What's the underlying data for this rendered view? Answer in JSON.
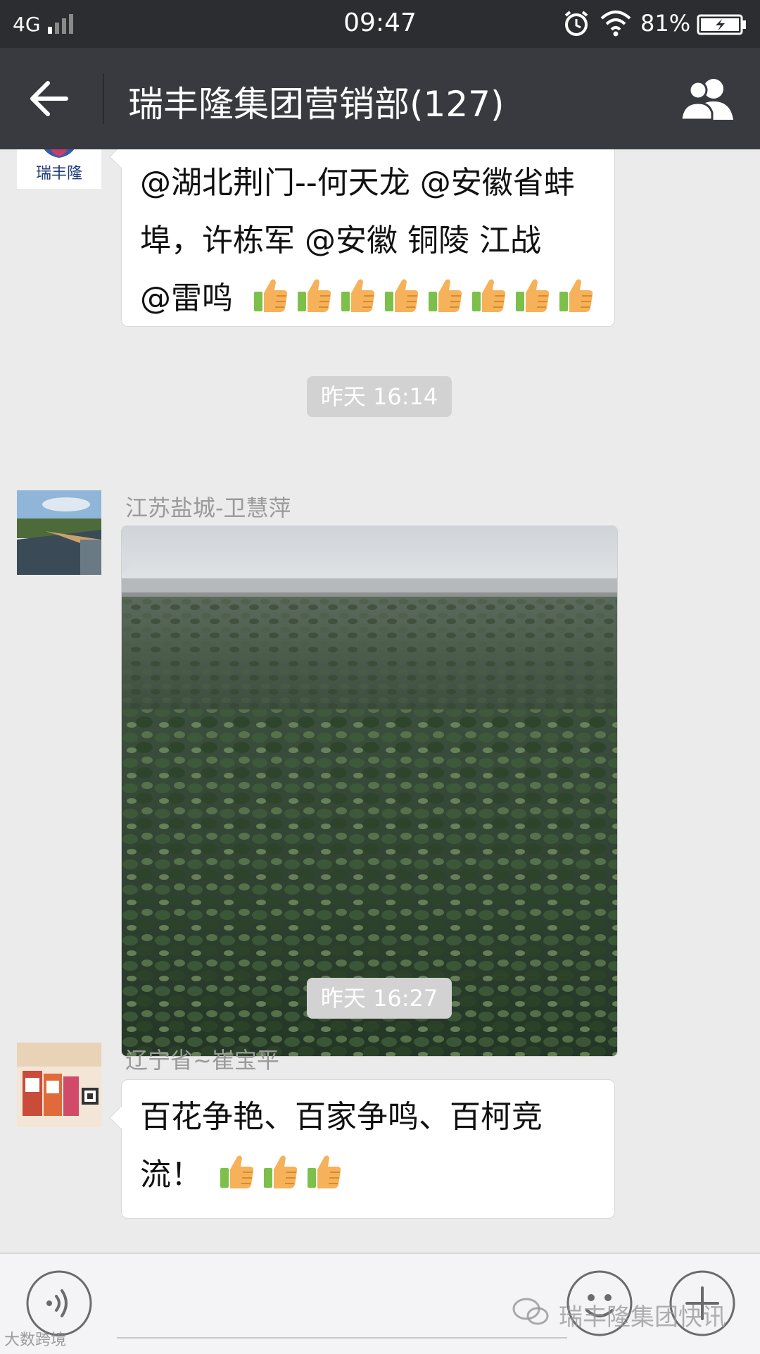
{
  "status_bar": {
    "network": "4G",
    "time": "09:47",
    "battery": "81%",
    "icons": [
      "signal-icon",
      "alarm-icon",
      "wifi-icon",
      "battery-charging-icon"
    ]
  },
  "header": {
    "title": "瑞丰隆集团营销部(127)",
    "icons": [
      "back-arrow-icon",
      "group-members-icon"
    ]
  },
  "messages": [
    {
      "avatar_text": "瑞丰隆",
      "text_lines": [
        "@湖北荆门--何天龙 @安徽省蚌",
        "埠，许栋军 @安徽 铜陵  江战",
        "@雷鸣"
      ],
      "thumbs_up_count": 8
    },
    {
      "timestamp": "昨天 16:14"
    },
    {
      "sender": "江苏盐城-卫慧萍",
      "type": "image",
      "image_desc": "green-vegetable-field-photo"
    },
    {
      "timestamp": "昨天 16:27"
    },
    {
      "sender": "辽宁省~崔宝平",
      "text_lines": [
        "百花争艳、百家争鸣、百柯竞",
        "流！"
      ],
      "thumbs_up_count": 3
    }
  ],
  "input_bar": {
    "icons": [
      "voice-icon",
      "emoji-icon",
      "plus-icon"
    ]
  },
  "watermarks": {
    "account": "瑞丰隆集团快讯",
    "corner": "大数跨境"
  },
  "colors": {
    "status_bar": "#2b2d30",
    "title_bar": "#393a3f",
    "chat_bg": "#ebebeb",
    "bubble": "#ffffff",
    "timestamp_bg": "#d2d2d2"
  }
}
